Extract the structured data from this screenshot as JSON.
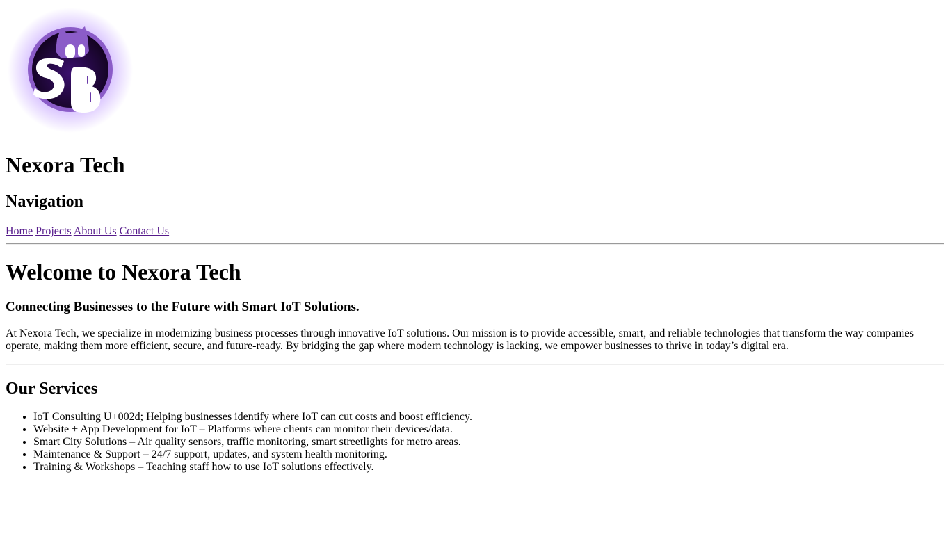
{
  "logo": {
    "name": "Nexora Tech logo",
    "colors": {
      "ring": "#8b5cc8",
      "inner": "#1a0633",
      "glow": "#b388ff",
      "letters": "#ffffff",
      "shadow": "#6a3aa8"
    }
  },
  "header": {
    "title": "Nexora Tech"
  },
  "navigation": {
    "heading": "Navigation",
    "links": [
      {
        "label": "Home"
      },
      {
        "label": "Projects"
      },
      {
        "label": "About Us"
      },
      {
        "label": "Contact Us"
      }
    ],
    "link_color": "#551a8b"
  },
  "main": {
    "title": "Welcome to Nexora Tech",
    "tagline": "Connecting Businesses to the Future with Smart IoT Solutions.",
    "intro": "At Nexora Tech, we specialize in modernizing business processes through innovative IoT solutions. Our mission is to provide accessible, smart, and reliable technologies that transform the way companies operate, making them more efficient, secure, and future-ready. By bridging the gap where modern technology is lacking, we empower businesses to thrive in today’s digital era."
  },
  "services": {
    "heading": "Our Services",
    "items": [
      "IoT Consulting U+002d; Helping businesses identify where IoT can cut costs and boost efficiency.",
      "Website + App Development for IoT – Platforms where clients can monitor their devices/data.",
      "Smart City Solutions – Air quality sensors, traffic monitoring, smart streetlights for metro areas.",
      "Maintenance & Support – 24/7 support, updates, and system health monitoring.",
      "Training & Workshops – Teaching staff how to use IoT solutions effectively."
    ]
  }
}
